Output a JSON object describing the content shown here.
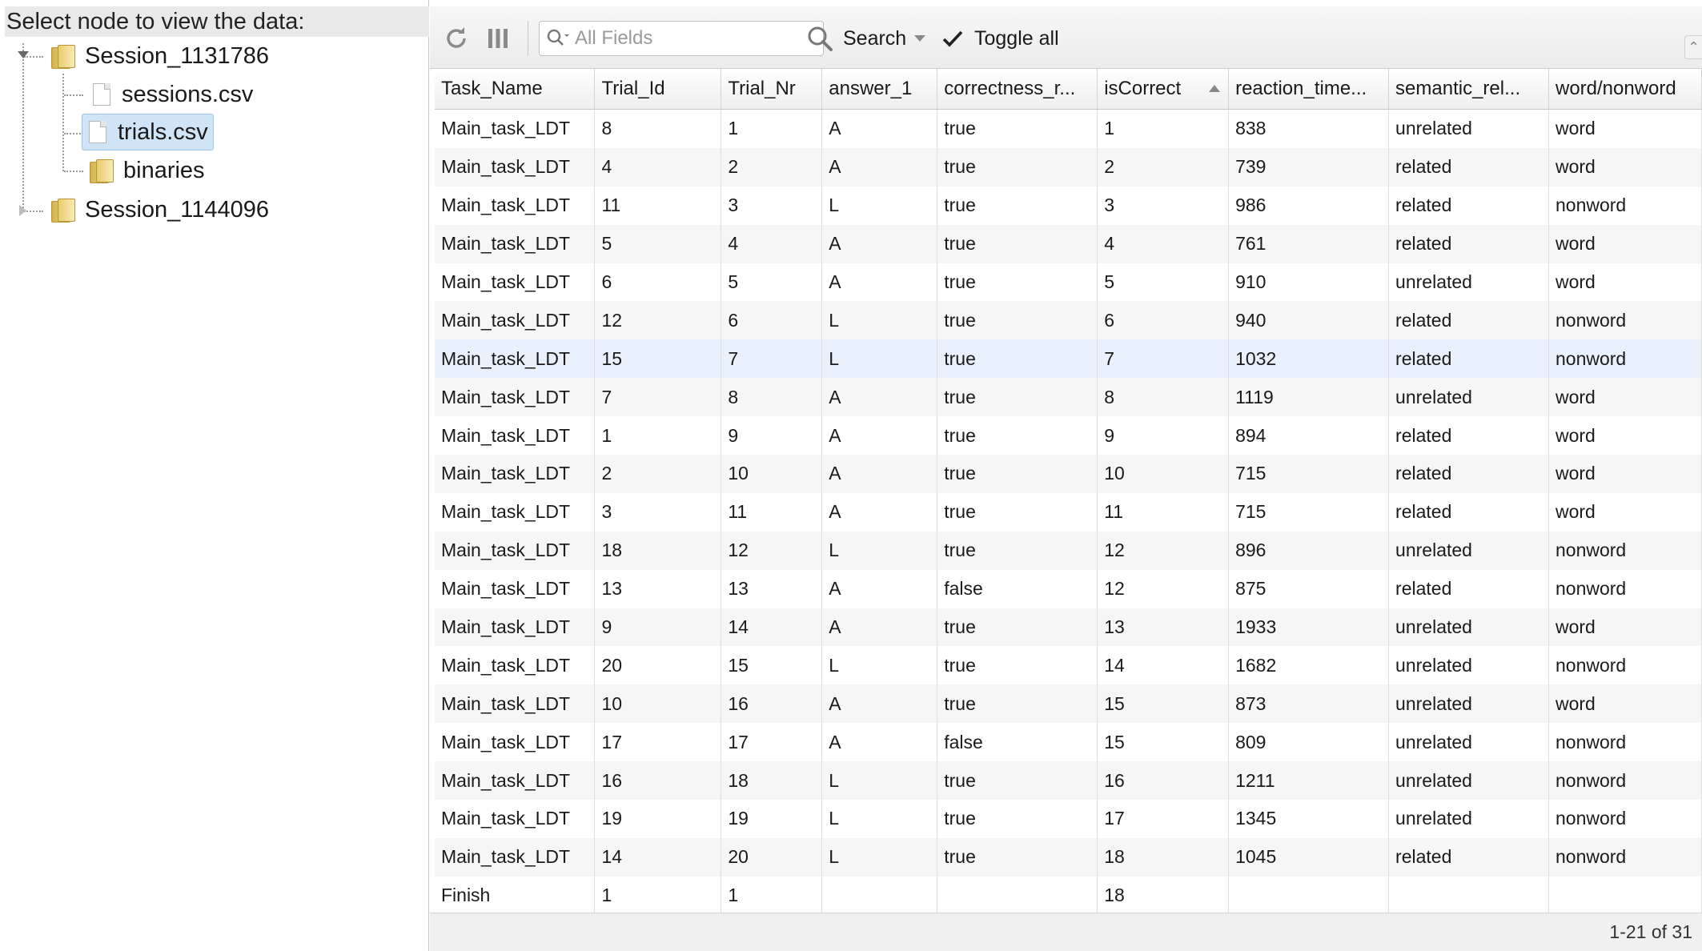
{
  "tree": {
    "title": "Select node to view the data:",
    "nodes": [
      {
        "label": "Session_1131786"
      },
      {
        "label": "sessions.csv"
      },
      {
        "label": "trials.csv"
      },
      {
        "label": "binaries"
      },
      {
        "label": "Session_1144096"
      }
    ]
  },
  "toolbar": {
    "search_placeholder": "All Fields",
    "search_label": "Search",
    "toggle_label": "Toggle all",
    "icons": [
      "refresh-icon",
      "columns-icon",
      "magnifier-icon",
      "checkmark-icon"
    ]
  },
  "table": {
    "columns": [
      "Task_Name",
      "Trial_Id",
      "Trial_Nr",
      "answer_1",
      "correctness_r...",
      "isCorrect",
      "reaction_time...",
      "semantic_rel...",
      "word/nonword"
    ],
    "sorted_column": "isCorrect",
    "rows": [
      [
        "Main_task_LDT",
        "8",
        "1",
        "A",
        "true",
        "1",
        "838",
        "unrelated",
        "word"
      ],
      [
        "Main_task_LDT",
        "4",
        "2",
        "A",
        "true",
        "2",
        "739",
        "related",
        "word"
      ],
      [
        "Main_task_LDT",
        "11",
        "3",
        "L",
        "true",
        "3",
        "986",
        "related",
        "nonword"
      ],
      [
        "Main_task_LDT",
        "5",
        "4",
        "A",
        "true",
        "4",
        "761",
        "related",
        "word"
      ],
      [
        "Main_task_LDT",
        "6",
        "5",
        "A",
        "true",
        "5",
        "910",
        "unrelated",
        "word"
      ],
      [
        "Main_task_LDT",
        "12",
        "6",
        "L",
        "true",
        "6",
        "940",
        "related",
        "nonword"
      ],
      [
        "Main_task_LDT",
        "15",
        "7",
        "L",
        "true",
        "7",
        "1032",
        "related",
        "nonword"
      ],
      [
        "Main_task_LDT",
        "7",
        "8",
        "A",
        "true",
        "8",
        "1119",
        "unrelated",
        "word"
      ],
      [
        "Main_task_LDT",
        "1",
        "9",
        "A",
        "true",
        "9",
        "894",
        "related",
        "word"
      ],
      [
        "Main_task_LDT",
        "2",
        "10",
        "A",
        "true",
        "10",
        "715",
        "related",
        "word"
      ],
      [
        "Main_task_LDT",
        "3",
        "11",
        "A",
        "true",
        "11",
        "715",
        "related",
        "word"
      ],
      [
        "Main_task_LDT",
        "18",
        "12",
        "L",
        "true",
        "12",
        "896",
        "unrelated",
        "nonword"
      ],
      [
        "Main_task_LDT",
        "13",
        "13",
        "A",
        "false",
        "12",
        "875",
        "related",
        "nonword"
      ],
      [
        "Main_task_LDT",
        "9",
        "14",
        "A",
        "true",
        "13",
        "1933",
        "unrelated",
        "word"
      ],
      [
        "Main_task_LDT",
        "20",
        "15",
        "L",
        "true",
        "14",
        "1682",
        "unrelated",
        "nonword"
      ],
      [
        "Main_task_LDT",
        "10",
        "16",
        "A",
        "true",
        "15",
        "873",
        "unrelated",
        "word"
      ],
      [
        "Main_task_LDT",
        "17",
        "17",
        "A",
        "false",
        "15",
        "809",
        "unrelated",
        "nonword"
      ],
      [
        "Main_task_LDT",
        "16",
        "18",
        "L",
        "true",
        "16",
        "1211",
        "unrelated",
        "nonword"
      ],
      [
        "Main_task_LDT",
        "19",
        "19",
        "L",
        "true",
        "17",
        "1345",
        "unrelated",
        "nonword"
      ],
      [
        "Main_task_LDT",
        "14",
        "20",
        "L",
        "true",
        "18",
        "1045",
        "related",
        "nonword"
      ],
      [
        "Finish",
        "1",
        "1",
        "",
        "",
        "18",
        "",
        "",
        ""
      ]
    ]
  },
  "footer": {
    "paging": "1-21 of 31"
  }
}
